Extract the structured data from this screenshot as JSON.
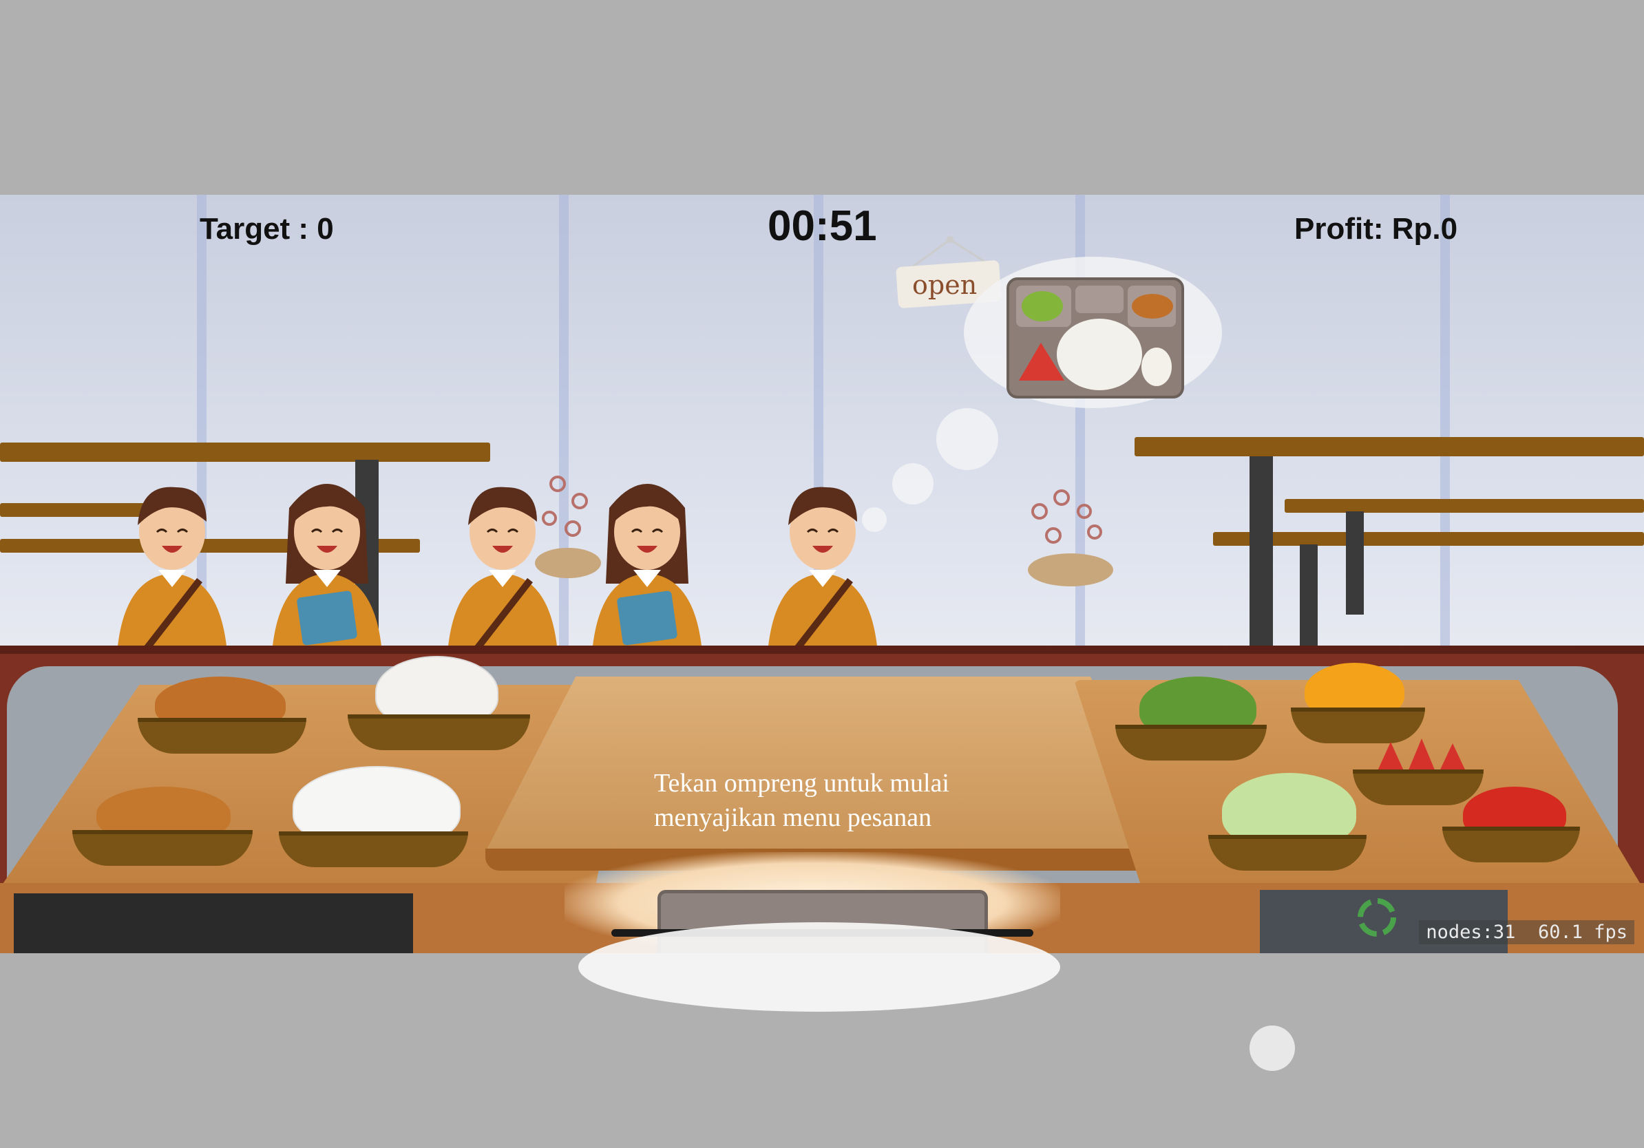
{
  "hud": {
    "target_label": "Target : 0",
    "timer": "00:51",
    "profit_label": "Profit: Rp.0"
  },
  "sign": {
    "text": "open"
  },
  "order_bubble": {
    "items": [
      "lettuce",
      "rice",
      "fried-chicken",
      "watermelon",
      "egg"
    ]
  },
  "instruction": {
    "line1": "Tekan ompreng untuk mulai",
    "line2": "menyajikan menu pesanan"
  },
  "debug": {
    "nodes": "nodes:31",
    "fps": "60.1 fps"
  },
  "students": [
    {
      "type": "boy"
    },
    {
      "type": "girl"
    },
    {
      "type": "boy"
    },
    {
      "type": "girl"
    },
    {
      "type": "boy"
    }
  ],
  "food_left": [
    "fried-chicken",
    "eggs",
    "fried-tofu",
    "rice"
  ],
  "food_right": [
    "broccoli",
    "oranges",
    "watermelon",
    "lettuce",
    "tomatoes"
  ],
  "colors": {
    "counter": "#7e3122",
    "table_wood": "#8a5a14",
    "uniform": "#d78b22",
    "plank": "#c9904f"
  }
}
